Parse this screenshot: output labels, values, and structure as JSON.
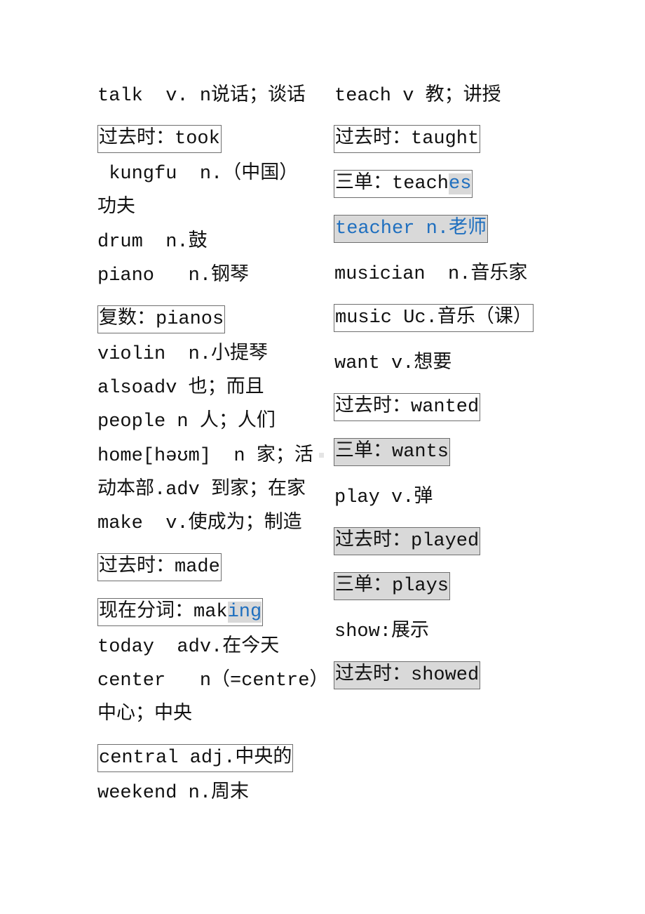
{
  "left_column": [
    {
      "id": "talk",
      "text": "talk  v. n说话；谈话",
      "boxed": false
    },
    {
      "id": "talk-past",
      "text": "过去时：took",
      "boxed": true
    },
    {
      "id": "kungfu-1",
      "text": " kungfu  n.（中国）",
      "boxed": false
    },
    {
      "id": "kungfu-2",
      "text": "功夫",
      "boxed": false
    },
    {
      "id": "drum",
      "text": "drum  n.鼓",
      "boxed": false
    },
    {
      "id": "piano",
      "text": "piano   n.钢琴",
      "boxed": false
    },
    {
      "id": "piano-plural",
      "text": "复数：pianos",
      "boxed": true
    },
    {
      "id": "violin",
      "text": "violin  n.小提琴",
      "boxed": false
    },
    {
      "id": "also",
      "text": "alsoadv 也；而且",
      "boxed": false
    },
    {
      "id": "people",
      "text": "people n 人；人们",
      "boxed": false
    },
    {
      "id": "home-1",
      "text": "home[həʊm]  n 家；活",
      "boxed": false
    },
    {
      "id": "home-2",
      "text": "动本部.adv 到家；在家",
      "boxed": false
    },
    {
      "id": "make",
      "text": "make  v.使成为；制造",
      "boxed": false
    },
    {
      "id": "make-past",
      "text": "过去时：made",
      "boxed": true
    },
    {
      "id": "make-ing",
      "prefix": "现在分词：mak",
      "suffix": "ing",
      "boxed": true
    },
    {
      "id": "today",
      "text": "today  adv.在今天",
      "boxed": false
    },
    {
      "id": "center-1",
      "text": "center   n（=centre）",
      "boxed": false
    },
    {
      "id": "center-2",
      "text": "中心；中央",
      "boxed": false
    },
    {
      "id": "central",
      "text": "central adj.中央的",
      "boxed": true
    },
    {
      "id": "weekend",
      "text": "weekend n.周末",
      "boxed": false
    }
  ],
  "right_column": [
    {
      "id": "teach",
      "text": "teach v 教；讲授",
      "boxed": false
    },
    {
      "id": "teach-past",
      "text": "过去时：taught",
      "boxed": true
    },
    {
      "id": "teach-3rd",
      "prefix": "三单：teach",
      "suffix": "es",
      "boxed": true
    },
    {
      "id": "teacher",
      "text": "teacher n.老师",
      "boxed": true,
      "shaded": true,
      "blue": true
    },
    {
      "id": "musician",
      "text": "musician  n.音乐家",
      "boxed": false
    },
    {
      "id": "music",
      "text": "music Uc.音乐（课）",
      "boxed": true
    },
    {
      "id": "want",
      "text": "want v.想要",
      "boxed": false
    },
    {
      "id": "want-past",
      "text": "过去时：wanted",
      "boxed": true
    },
    {
      "id": "want-3rd",
      "text": "三单：wants",
      "boxed": true,
      "shaded": true
    },
    {
      "id": "play",
      "text": "play v.弹",
      "boxed": false
    },
    {
      "id": "play-past",
      "text": "过去时：played",
      "boxed": true,
      "shaded": true
    },
    {
      "id": "play-3rd",
      "text": "三单：plays",
      "boxed": true,
      "shaded": true
    },
    {
      "id": "show",
      "text": "show:展示",
      "boxed": false
    },
    {
      "id": "show-past",
      "text": "过去时：showed",
      "boxed": true,
      "shaded": true
    }
  ],
  "colors": {
    "text": "#111111",
    "highlight_blue": "#1f6fbf",
    "shade_gray": "#d9d9d9",
    "box_border": "#6e6e6e"
  }
}
